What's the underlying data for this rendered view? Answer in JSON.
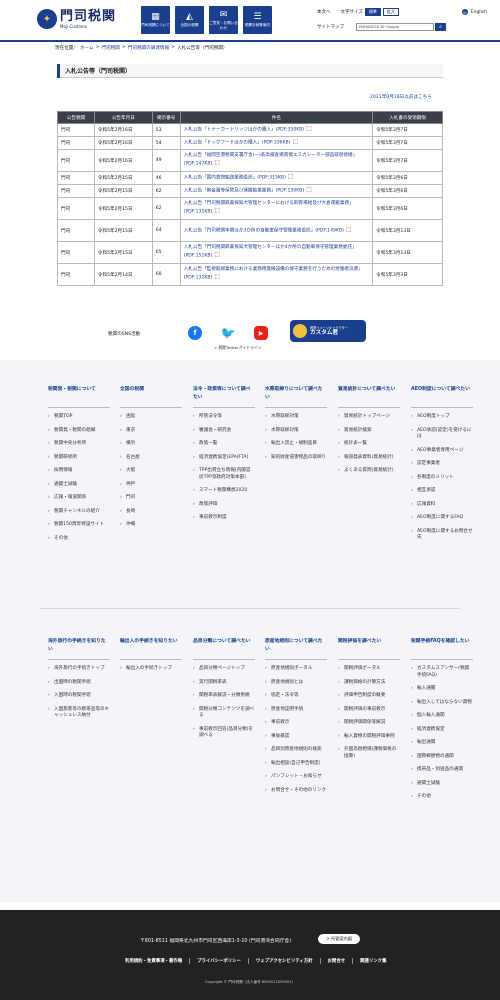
{
  "header": {
    "logo_main": "門司税関",
    "logo_sub": "Moji Customs",
    "buttons": [
      {
        "icon": "building-icon",
        "label": "門司税関について"
      },
      {
        "icon": "map-icon",
        "label": "全国の税関"
      },
      {
        "icon": "mail-icon",
        "label": "ご意見・お問い合わせ"
      },
      {
        "icon": "chat-icon",
        "label": "税関手続等案内"
      }
    ],
    "text_only": "本文へ",
    "font_size_label": "文字サイズ",
    "font_standard": "標準",
    "font_large": "拡大",
    "english": "English",
    "sitemap": "サイトマップ",
    "search_placeholder": "ENHANCED BY Google"
  },
  "breadcrumb": {
    "prefix": "現在位置：",
    "items": [
      "ホーム",
      "門司税関",
      "門司税関の調達情報",
      "入札公告等（門司税関）"
    ]
  },
  "page": {
    "title": "入札公告等（門司税関）",
    "archive_link": "2021年9月18日以前はこちら"
  },
  "table": {
    "headers": [
      "公告税関",
      "公告年月日",
      "掲示番号",
      "件名",
      "入札書の受領期限"
    ],
    "rows": [
      {
        "office": "門司",
        "date": "令和5年2月16日",
        "num": "53",
        "title": "入札公告「トナーカートリッジほかの購入」(PDF:350KB)",
        "deadline": "令和5年3月7日"
      },
      {
        "office": "門司",
        "date": "令和5年2月16日",
        "num": "54",
        "title": "入札公告「ドッグフードほかの購入」(PDF:336KB)",
        "deadline": "令和5年3月7日"
      },
      {
        "office": "門司",
        "date": "令和5年2月16日",
        "num": "49",
        "title": "入札公告「福岡空港税関支署庁舎(一)系高検査場南側エスカレーター部品取替修繕」(PDF:147KB)",
        "deadline": "令和5年3月7日"
      },
      {
        "office": "門司",
        "date": "令和5年2月15日",
        "num": "46",
        "title": "入札公告「国内貨物輸送業務委託」(PDF:315KB)",
        "deadline": "令和5年3月6日"
      },
      {
        "office": "門司",
        "date": "令和5年2月15日",
        "num": "62",
        "title": "入札公告「麻金属等保管及び運搬輸業業務」(PDF:130KB)",
        "deadline": "令和5年3月6日"
      },
      {
        "office": "門司",
        "date": "令和5年2月15日",
        "num": "62",
        "title": "入札公告「門司税関麻薬探知犬管理センターにおける飼育場給及び大倉運搬業務」(PDF:131KB)",
        "deadline": "令和5年3月6日"
      },
      {
        "office": "門司",
        "date": "令和5年2月15日",
        "num": "64",
        "title": "入札公告「門司税関本関ほか3か所の自動車保守管理業務委託」(PDF:149KB)",
        "deadline": "令和5年3月13日"
      },
      {
        "office": "門司",
        "date": "令和5年2月15日",
        "num": "65",
        "title": "入札公告「門司税関麻薬探知犬管理センターほか4か所の自動車保守管理業務委託」(PDF:151KB)",
        "deadline": "令和5年3月13日"
      },
      {
        "office": "門司",
        "date": "令和5年2月14日",
        "num": "60",
        "title": "入札公告「監視取締業務における業務用無線設備の保守業務を行うための労働者派遣」(PDF:132KB)",
        "deadline": "令和5年3月3日"
      }
    ]
  },
  "sns": {
    "label": "税関のSNS活動",
    "guideline": "> 税関Twitterガイドライン",
    "kastam_small": "税関イメージキャラクター",
    "kastam_big": "カスタム君"
  },
  "footer_nav": {
    "row1": [
      {
        "heading": "税関発・税関について",
        "items": [
          "税関TOP",
          "税関発・税関の組織",
          "税関中央分析所",
          "税関研修所",
          "採用情報",
          "通関士試験",
          "広報・報道関係",
          "税関チャンネルの紹介",
          "税関150周年特設サイト",
          "その他"
        ]
      },
      {
        "heading": "全国の税関",
        "items": [
          "函館",
          "東京",
          "横浜",
          "名古屋",
          "大阪",
          "神戸",
          "門司",
          "長崎",
          "沖縄"
        ]
      },
      {
        "heading": "法令・政策等について調べたい",
        "items": [
          "所管法令等",
          "審議会・研究会",
          "政策一覧",
          "経済連携協定(EPA/FTA)",
          "TPP出荷立ち情報(内閣官房TPP等政府対策本部)",
          "スマート税関構想2020",
          "政策評価",
          "事前教示制度"
        ]
      },
      {
        "heading": "水際取締りについて調べたい",
        "items": [
          "水際取締対策",
          "水際取締対策",
          "輸出入禁止・規制品目",
          "知的財産侵害物品の取締り"
        ]
      },
      {
        "heading": "貿易統計について調べたい",
        "items": [
          "貿易統計トップページ",
          "貿易統計検索",
          "統計表一覧",
          "報道発表資料(貿易統計)",
          "よくある質問(貿易統計)"
        ]
      },
      {
        "heading": "AEO制度について調べたい",
        "items": [
          "AEO制度トップ",
          "AEO承認(認定)を受けるには",
          "AEO事業者専用ページ",
          "認定事業者",
          "各制度のメリット",
          "相互承認",
          "広報資料",
          "AEO制度に関するFAQ",
          "AEO制度に関するお問合せ先"
        ]
      }
    ],
    "row2": [
      {
        "heading": "海外旅行の手続きを知りたい",
        "items": [
          "海外旅行の手続きトップ",
          "出国時の税関手続",
          "入国時の税関手続",
          "入国旅客等の携帯品等のキャッシュレス納付"
        ]
      },
      {
        "heading": "輸出入の手続きを知りたい",
        "items": [
          "輸出入の手続きトップ"
        ]
      },
      {
        "heading": "品目分類について調べたい",
        "items": [
          "品目分類ページトップ",
          "実行関税率表",
          "関税率表解説・分類例規",
          "関税分類コンテンツを調べる",
          "事前教示回答(品目分類)を調べる"
        ]
      },
      {
        "heading": "原産地規則について調べたい",
        "items": [
          "原産地規則ポータル",
          "原産地規則とは",
          "協定・法令等",
          "原産地証明手続",
          "事前教示",
          "事後確認",
          "品目別原産地規則の検索",
          "輸出相談(自己申告制度)",
          "パンフレット・お知らせ",
          "お問合せ・その他のリンク"
        ]
      },
      {
        "heading": "関税評価を調べたい",
        "items": [
          "関税評価ポータル",
          "課税価格の計算方法",
          "評価申告制度の概要",
          "関税評価の事前教示",
          "関税評価関係等解説",
          "輸入貨物の関税評価事例",
          "外国為替相場(課税価格の換算)"
        ]
      },
      {
        "heading": "税関手続FAQを確認したい",
        "items": [
          "カスタムスアンサー(税関手続FAQ)",
          "輸入通關",
          "輸出入してはならない貨物",
          "個人輸入通関",
          "経済連携協定",
          "輸出通関",
          "国際郵便物の通関",
          "携帯品・別送品の通関",
          "通関士試験",
          "その他"
        ]
      }
    ]
  },
  "footer": {
    "address": "〒801-8511 福岡県北九州市門司区西海岸1-3-10 (門司港湾合同庁舎)",
    "map_button": "> 所管案内図",
    "links": [
      "利用規約・免責事項・著作権",
      "プライバシーポリシー",
      "ウェブアクセシビリティ方針",
      "お問合せ",
      "関連リンク集"
    ],
    "copyright": "Copyright © 門司税関（法人番号 8000012050001）"
  }
}
